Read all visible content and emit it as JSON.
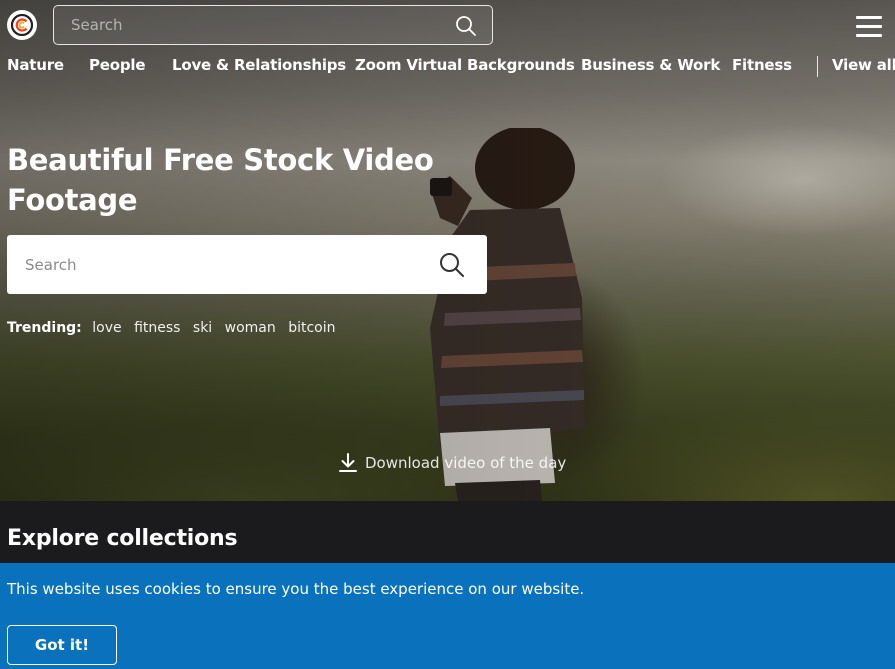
{
  "header": {
    "search_placeholder": "Search",
    "logo_icon": "brand-logo-icon",
    "menu_icon": "hamburger-menu-icon"
  },
  "nav": {
    "categories": [
      {
        "label": "Nature"
      },
      {
        "label": "People"
      },
      {
        "label": "Love & Relationships"
      },
      {
        "label": "Zoom Virtual Backgrounds"
      },
      {
        "label": "Business & Work"
      },
      {
        "label": "Fitness"
      }
    ],
    "view_all": "View all"
  },
  "hero": {
    "title": "Beautiful Free Stock Video Footage",
    "search_placeholder": "Search",
    "trending_label": "Trending:",
    "trending_tags": [
      "love",
      "fitness",
      "ski",
      "woman",
      "bitcoin"
    ],
    "download_label": "Download video of the day"
  },
  "explore": {
    "title": "Explore collections"
  },
  "cookie": {
    "message": "This website uses cookies to ensure you the best experience on our website.",
    "button_label": "Got it!"
  },
  "colors": {
    "cookie_bg": "#0a71bd",
    "dark_bg": "#1b1b1d",
    "text": "#ffffff"
  }
}
